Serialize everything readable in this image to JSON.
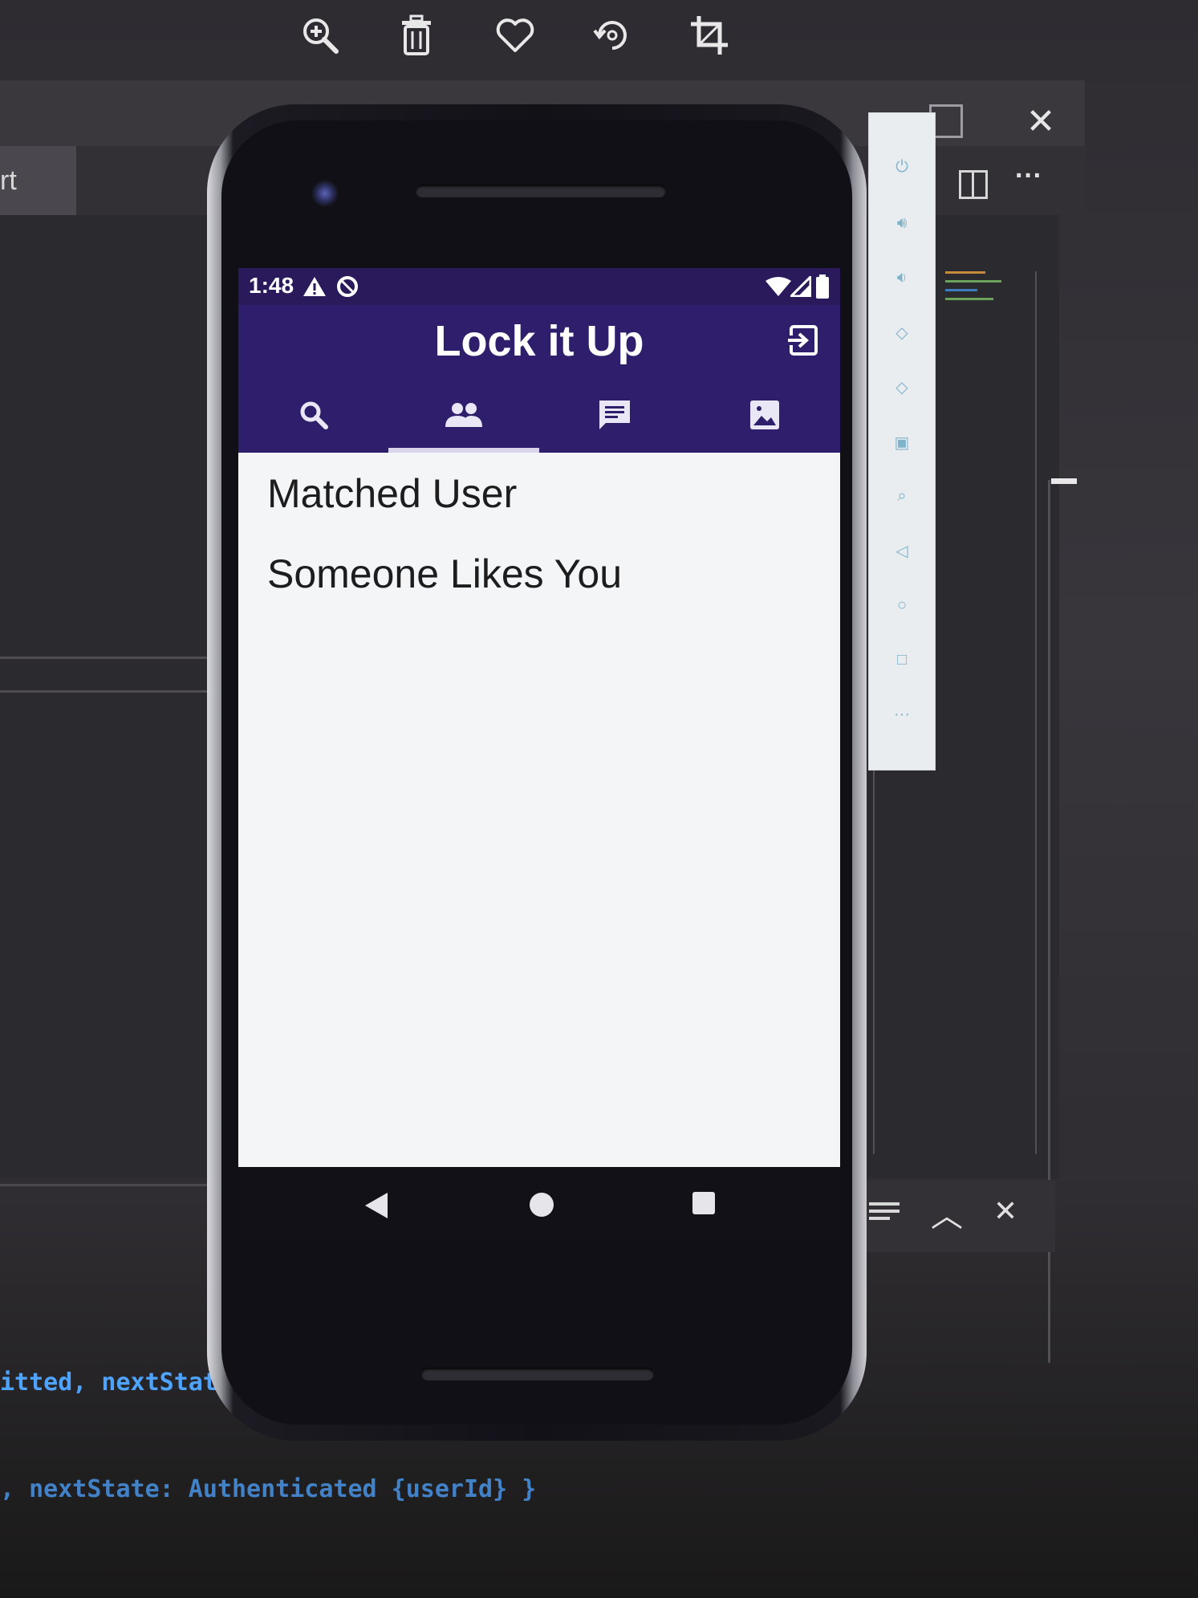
{
  "viewer_toolbar": {
    "icons": [
      "zoom-in-icon",
      "trash-icon",
      "heart-icon",
      "rotate-icon",
      "crop-icon"
    ]
  },
  "ide": {
    "tab_label": "rt",
    "code_line_1": "itted, nextState",
    "code_line_2": ", nextState: Authenticated {userId} }",
    "close_glyph": "✕",
    "more_glyph": "···"
  },
  "emulator_toolbar": {
    "icons": [
      "power-icon",
      "volume-up-icon",
      "volume-down-icon",
      "rotate-left-icon",
      "rotate-right-icon",
      "camera-icon",
      "zoom-icon",
      "back-icon",
      "home-icon",
      "overview-icon",
      "more-icon"
    ]
  },
  "status_bar": {
    "time": "1:48"
  },
  "app": {
    "title": "Lock it Up",
    "tabs": [
      {
        "icon": "search-icon"
      },
      {
        "icon": "people-icon"
      },
      {
        "icon": "chat-icon"
      },
      {
        "icon": "image-icon"
      }
    ],
    "active_tab_index": 1,
    "items": [
      {
        "label": "Matched User"
      },
      {
        "label": "Someone Likes You"
      }
    ]
  },
  "colors": {
    "app_bar": "#2f1e6b",
    "status_bar": "#2a1a5c"
  }
}
